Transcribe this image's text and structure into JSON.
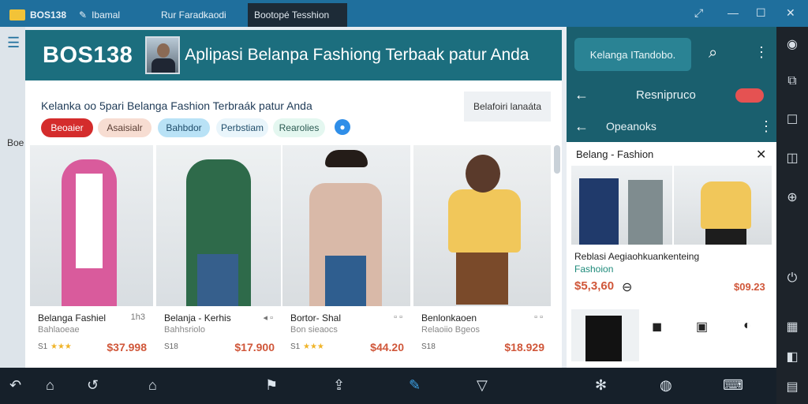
{
  "window": {
    "title": "BOS138",
    "tabs": [
      {
        "label": "Ibamal"
      },
      {
        "label": "Rur Faradkaodi"
      },
      {
        "label": "Bootopé Tesshion"
      }
    ]
  },
  "header": {
    "brand": "BOS138",
    "subtitle": "Aplipasi Belanpa Fashiong Terbaak patur Anda"
  },
  "left_side": {
    "label": "Boe"
  },
  "section": {
    "title": "Kelanka oo 5pari Belanga Fashion Terbraák patur Anda",
    "button": "Belafoiri lanaáta"
  },
  "chips": [
    {
      "label": "Beoaier"
    },
    {
      "label": "Asaisialr"
    },
    {
      "label": "Bahbdor"
    },
    {
      "label": "Perbstiam"
    },
    {
      "label": "Rearolies"
    }
  ],
  "products": [
    {
      "title": "Belanga Fashiel",
      "tag": "1h3",
      "sub": "Bahlaoeae",
      "meta": "S1",
      "rating": "★★★",
      "price": "$37.998",
      "color": "#d95b9c"
    },
    {
      "title": "Belanja - Kerhis",
      "tag": "◂ ▫",
      "sub": "Bahhsriolo",
      "meta": "S18",
      "rating": "",
      "price": "$17.900",
      "color": "#2e6a4a"
    },
    {
      "title": "Bortor- Shal",
      "tag": "▫ ▫",
      "sub": "Bon sieaocs",
      "meta": "S1",
      "rating": "★★★",
      "price": "$44.20",
      "color": "#d9b9a8"
    },
    {
      "title": "Benlonkaoen",
      "tag": "▫ ▫",
      "sub": "Relaoiio Bgeos",
      "meta": "S18",
      "rating": "",
      "price": "$18.929",
      "color": "#f1c75a"
    }
  ],
  "right": {
    "search_label": "Kelanga ITandobo.",
    "row1": "Resnipruco",
    "row2": "Opeanoks",
    "filter_title": "Belang - Fashion",
    "item_title": "Reblasi Aegiaohkuankenteing",
    "item_cat": "Fashoion",
    "price_left": "$5,3,60",
    "price_right": "$09.23"
  },
  "colors": {
    "accent": "#1c6e7e",
    "brand": "#1f6f9d",
    "price": "#d0573a"
  }
}
